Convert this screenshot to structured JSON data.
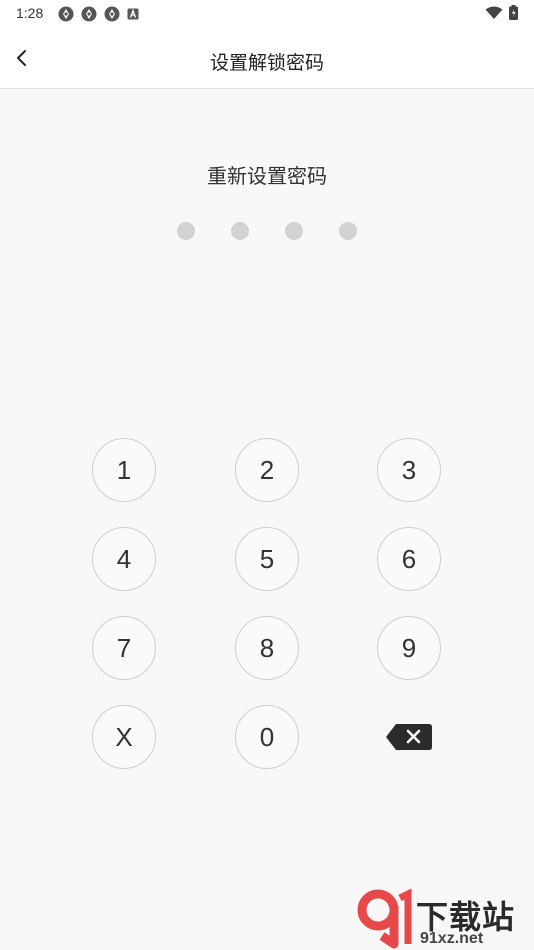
{
  "status_bar": {
    "time": "1:28",
    "left_icons": [
      "app-notification-icon",
      "app-notification-icon",
      "app-notification-icon",
      "a-notification-icon"
    ],
    "right_icons": [
      "wifi-icon",
      "battery-icon"
    ]
  },
  "header": {
    "title": "设置解锁密码",
    "back_icon": "chevron-left-icon"
  },
  "main": {
    "prompt": "重新设置密码",
    "pin_dot_count": 4,
    "pin_filled": 0
  },
  "keypad": {
    "keys": [
      "1",
      "2",
      "3",
      "4",
      "5",
      "6",
      "7",
      "8",
      "9",
      "X",
      "0"
    ],
    "backspace_icon": "backspace-icon"
  },
  "watermark": {
    "logo_mark": "91",
    "title": "下载站",
    "domain": "91xz.net"
  },
  "colors": {
    "background": "#f8f8f8",
    "pin_dot": "#d2d2d2",
    "key_border": "#cfcfcf",
    "text": "#333333",
    "watermark_red": "#e8484a"
  }
}
